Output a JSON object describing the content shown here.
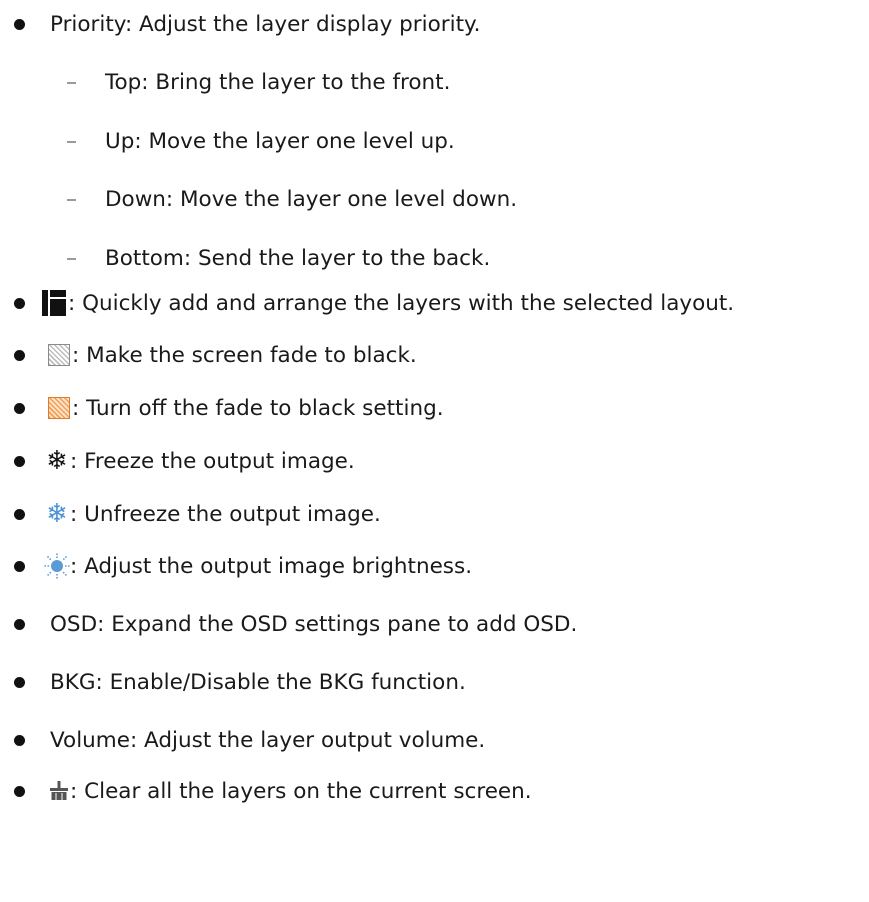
{
  "items": [
    {
      "text": "Priority: Adjust the layer display priority."
    },
    {
      "text": "Top: Bring the layer to the front."
    },
    {
      "text": "Up: Move the layer one level up."
    },
    {
      "text": "Down: Move the layer one level down."
    },
    {
      "text": "Bottom: Send the layer to the back."
    },
    {
      "icon": "layout-icon",
      "text": ": Quickly add and arrange the layers with the selected layout."
    },
    {
      "icon": "fade-to-black-icon",
      "text": ": Make the screen fade to black."
    },
    {
      "icon": "fade-to-black-active-icon",
      "text": ": Turn off the fade to black setting."
    },
    {
      "icon": "freeze-icon",
      "text": ": Freeze the output image."
    },
    {
      "icon": "unfreeze-icon",
      "text": ": Unfreeze the output image."
    },
    {
      "icon": "brightness-icon",
      "text": ": Adjust the output image brightness."
    },
    {
      "text": "OSD: Expand the OSD settings pane to add OSD."
    },
    {
      "text": "BKG: Enable/Disable the BKG function."
    },
    {
      "text": "Volume: Adjust the layer output volume."
    },
    {
      "icon": "clear-layers-icon",
      "text": ": Clear all the layers on the current screen."
    }
  ],
  "glyphs": {
    "freeze": "❄",
    "unfreeze": "❄"
  },
  "colors": {
    "text": "#1a1a1a",
    "fade_active": "#f0a058",
    "unfreeze": "#4a90d9",
    "brightness": "#5b9bd5"
  }
}
